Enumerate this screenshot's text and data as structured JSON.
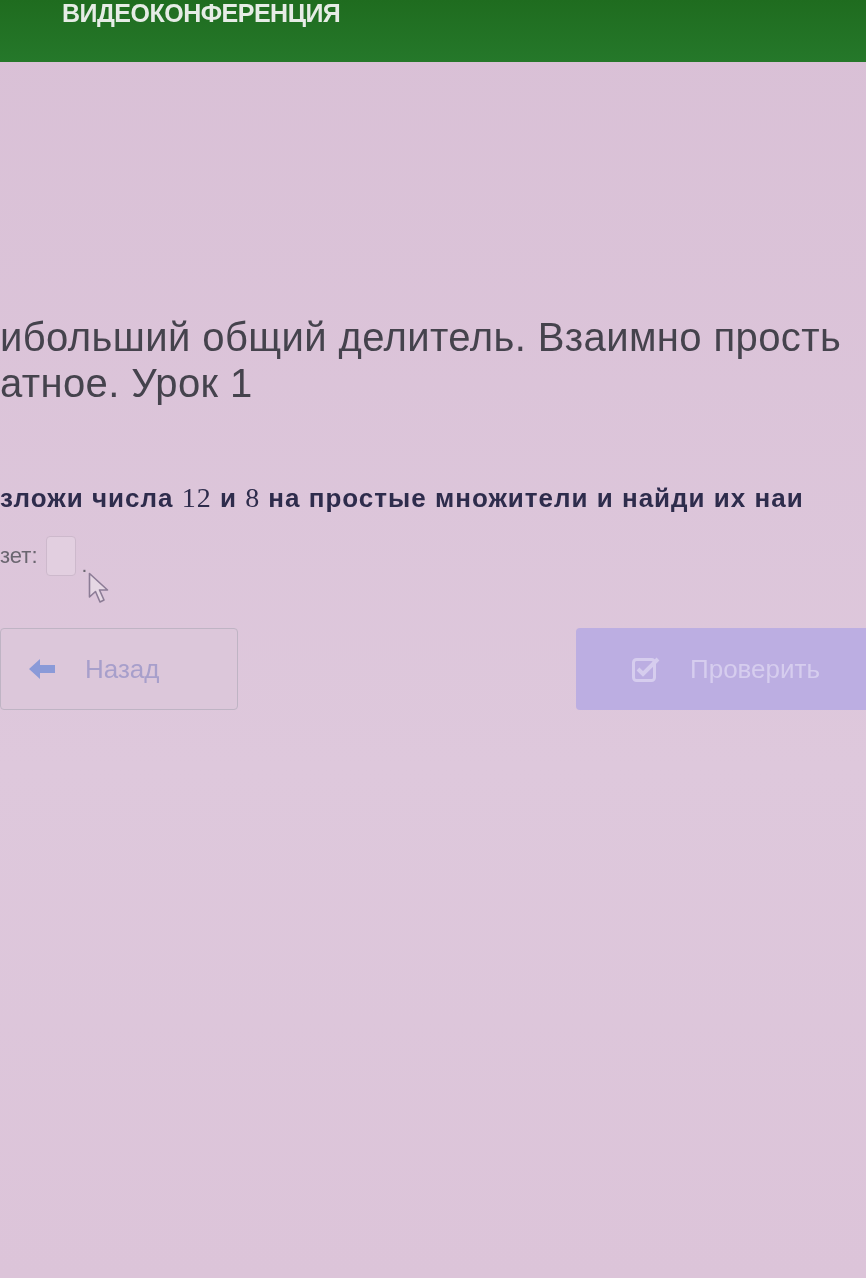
{
  "header": {
    "title": "ВИДЕОКОНФЕРЕНЦИЯ"
  },
  "lesson": {
    "title_lines": [
      "ибольший общий делитель. Взаимно прость",
      "атное. Урок 1"
    ]
  },
  "task": {
    "parts": [
      {
        "kind": "text",
        "text": "зложи числа "
      },
      {
        "kind": "number",
        "text": "12"
      },
      {
        "kind": "text",
        "text": " и "
      },
      {
        "kind": "number",
        "text": "8"
      },
      {
        "kind": "text",
        "text": " на простые множители и найди их наи"
      }
    ]
  },
  "answer": {
    "label": "зет:",
    "suffix": "."
  },
  "buttons": [
    {
      "kind": "back",
      "label": "Назад",
      "disabled": false
    },
    {
      "kind": "check",
      "label": "Проверить",
      "disabled": true
    }
  ]
}
